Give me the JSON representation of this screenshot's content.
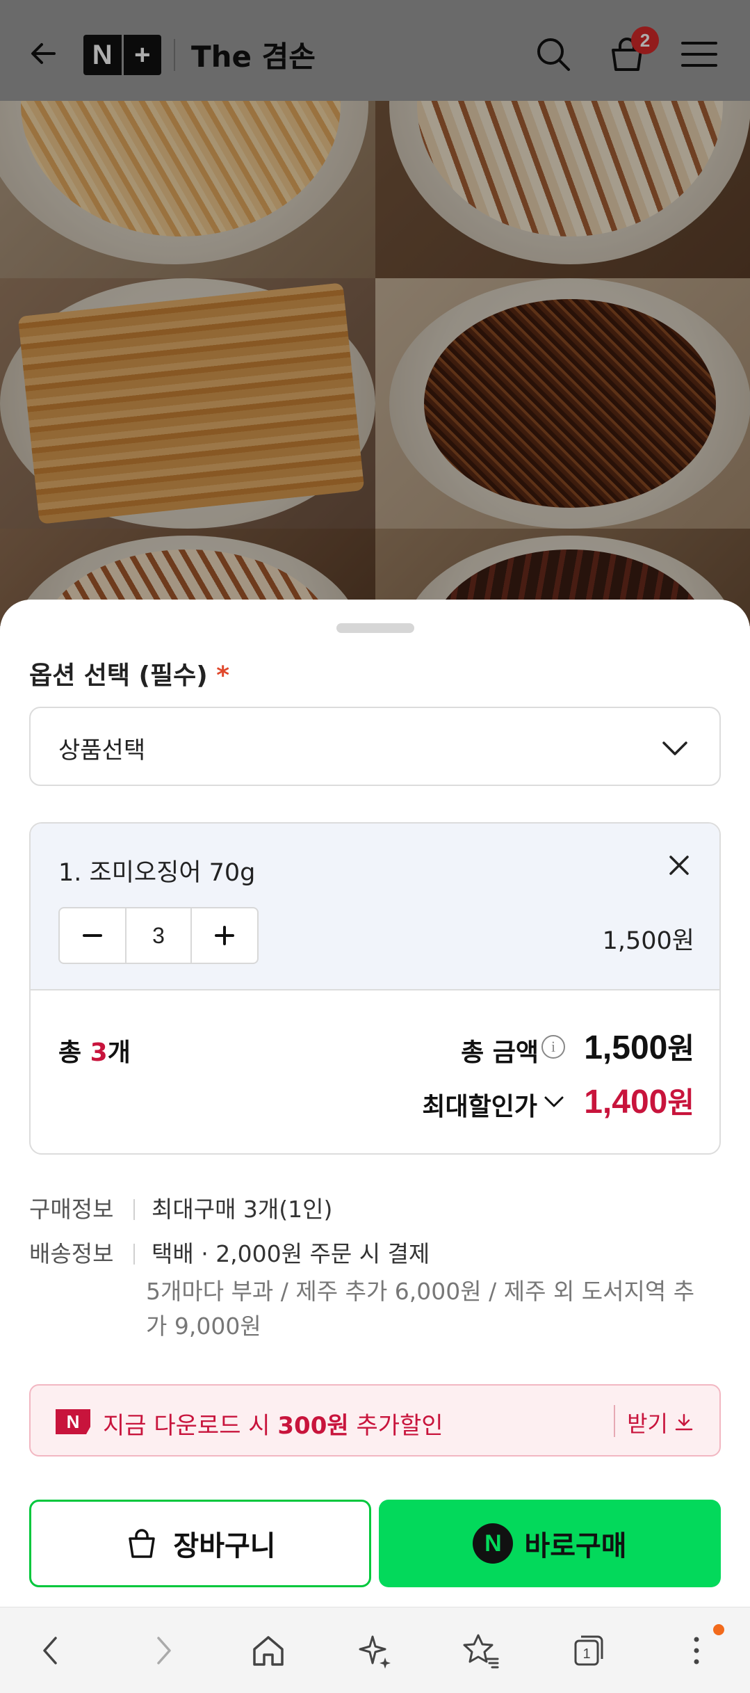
{
  "header": {
    "brand_logo_left": "N",
    "brand_logo_right": "+",
    "brand_name": "The 겸손",
    "cart_count": "2",
    "icons": [
      "back-arrow-icon",
      "search-icon",
      "cart-icon",
      "menu-icon"
    ]
  },
  "product_photos": [
    "dried-squid-strips",
    "squid-sticks",
    "grilled-squid",
    "seasoned-squid",
    "squid-jerky",
    "red-squid-sticks"
  ],
  "option": {
    "title": "옵션 선택 (필수)",
    "required_mark": "*",
    "select_value": "상품선택"
  },
  "selected_item": {
    "name": "1. 조미오징어 70g",
    "quantity": "3",
    "price": "1,500원"
  },
  "totals": {
    "count_prefix": "총 ",
    "count_value": "3",
    "count_suffix": "개",
    "amount_label": "총 금액",
    "amount_value": "1,500",
    "discount_label": "최대할인가",
    "discount_value": "1,400",
    "currency": "원"
  },
  "purchase_info": {
    "label": "구매정보",
    "text": "최대구매 3개(1인)"
  },
  "shipping_info": {
    "label": "배송정보",
    "text": "택배 · 2,000원 주문 시 결제",
    "extra": "5개마다 부과 / 제주 추가 6,000원 / 제주 외 도서지역 추가 9,000원"
  },
  "coupon": {
    "logo": "N",
    "text_before": "지금 다운로드 시 ",
    "text_bold": "300원",
    "text_after": " 추가할인",
    "button_label": "받기"
  },
  "buttons": {
    "cart_label": "장바구니",
    "buy_label": "바로구매",
    "buy_logo": "N"
  },
  "browser_nav": {
    "tab_count": "1",
    "icons": [
      "back-icon",
      "forward-icon",
      "home-icon",
      "ai-sparkle-icon",
      "bookmarks-icon",
      "tabs-icon",
      "more-icon"
    ]
  },
  "colors": {
    "accent_red": "#c8143c",
    "buy_green": "#03d95b",
    "cart_border_green": "#00c73c"
  }
}
